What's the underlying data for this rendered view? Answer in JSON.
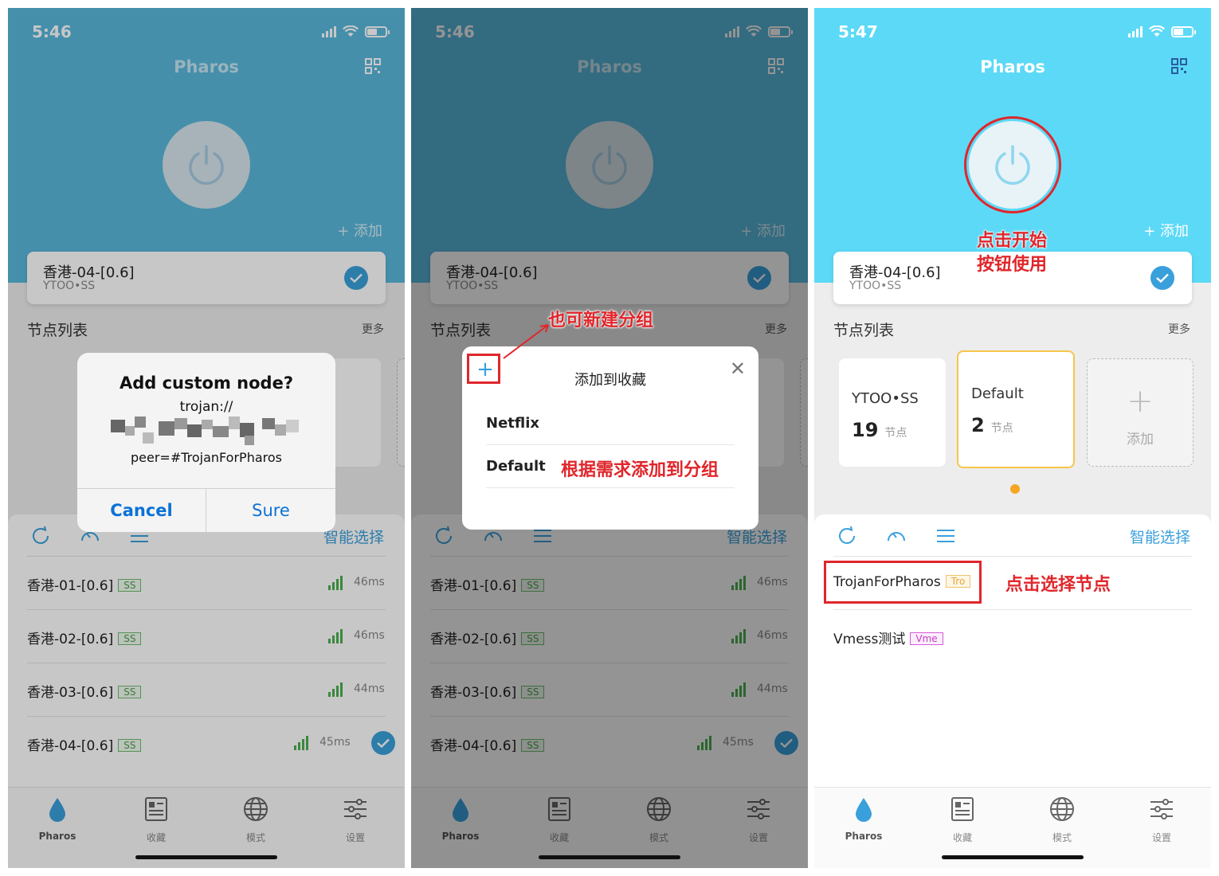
{
  "app": {
    "title": "Pharos",
    "add_label": "+ 添加",
    "current_node": {
      "name": "香港-04-[0.6]",
      "sub": "YTOO•SS"
    },
    "section_title": "节点列表",
    "more_label": "更多",
    "smart_select": "智能选择",
    "tabs": [
      "Pharos",
      "收藏",
      "模式",
      "设置"
    ]
  },
  "phone1": {
    "time": "5:46",
    "alert": {
      "title": "Add custom node?",
      "line1": "trojan://",
      "line2": "peer=#TrojanForPharos",
      "cancel": "Cancel",
      "sure": "Sure"
    },
    "nodes": [
      {
        "name": "香港-01-[0.6]",
        "tag": "SS",
        "latency": "46ms"
      },
      {
        "name": "香港-02-[0.6]",
        "tag": "SS",
        "latency": "46ms"
      },
      {
        "name": "香港-03-[0.6]",
        "tag": "SS",
        "latency": "44ms"
      },
      {
        "name": "香港-04-[0.6]",
        "tag": "SS",
        "latency": "45ms"
      }
    ]
  },
  "phone2": {
    "time": "5:46",
    "sheet": {
      "title": "添加到收藏",
      "rows": [
        "Netflix",
        "Default"
      ]
    },
    "annotations": {
      "new_group": "也可新建分组",
      "add_to_group": "根据需求添加到分组"
    }
  },
  "phone3": {
    "time": "5:47",
    "groups": [
      {
        "name": "YTOO•SS",
        "count": "19",
        "unit": "节点"
      },
      {
        "name": "Default",
        "count": "2",
        "unit": "节点"
      }
    ],
    "add_group_label": "添加",
    "nodes": [
      {
        "name": "TrojanForPharos",
        "tag": "Tro"
      },
      {
        "name": "Vmess测试",
        "tag": "Vme"
      }
    ],
    "annotations": {
      "start_line1": "点击开始",
      "start_line2": "按钮使用",
      "select_node": "点击选择节点"
    }
  },
  "colors": {
    "header": "#59b8dc",
    "header_active": "#5cd9f7",
    "accent": "#3aa0dc",
    "annotation_red": "#e0262b"
  }
}
